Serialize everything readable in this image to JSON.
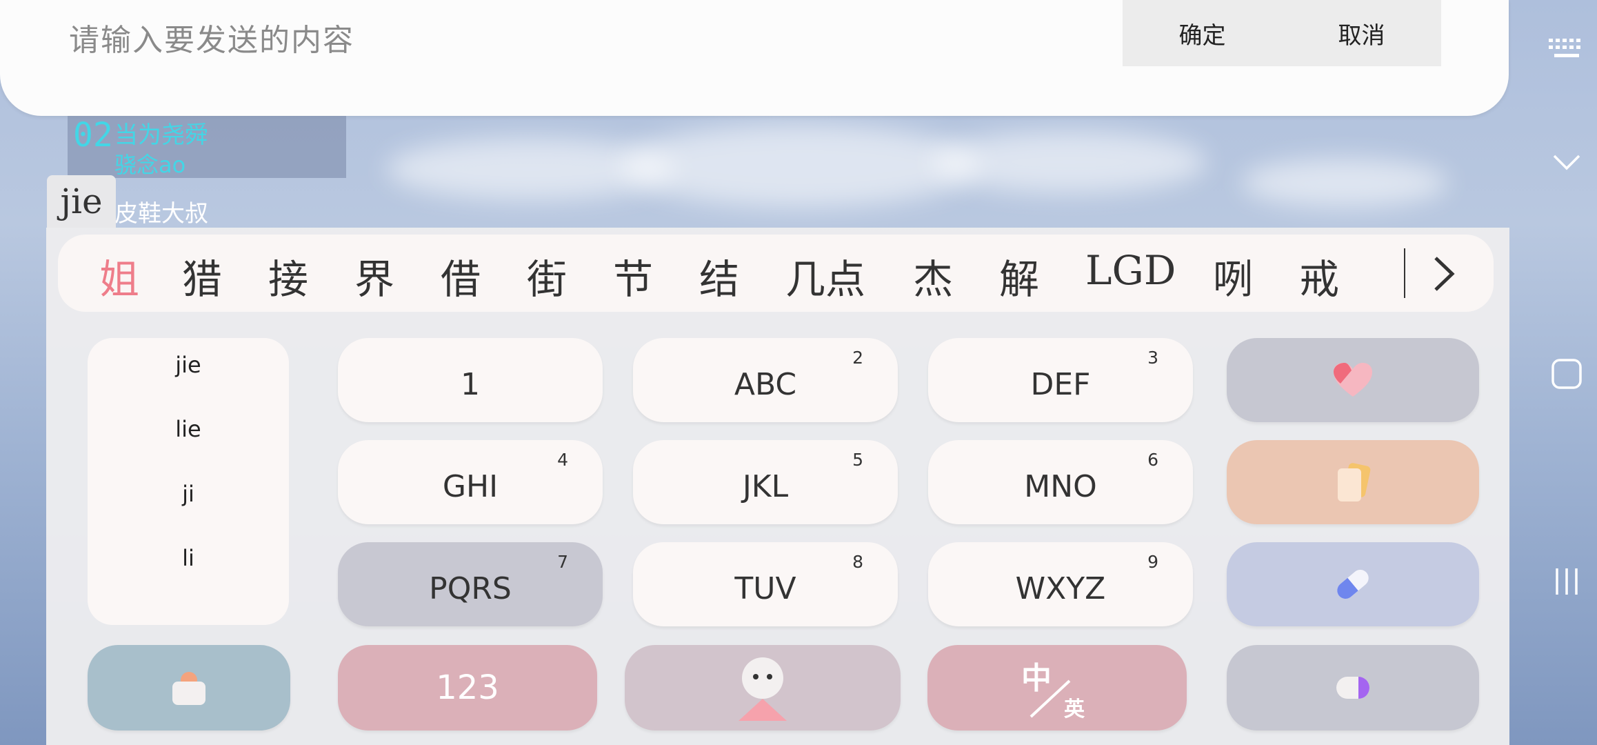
{
  "input": {
    "placeholder": "请输入要发送的内容",
    "confirm_label": "确定",
    "cancel_label": "取消"
  },
  "lyrics": {
    "number": "02",
    "line1": "当为尧舜",
    "line2": "骁念ao",
    "line3": "皮鞋大叔"
  },
  "composing_pinyin": "jie",
  "candidates": [
    "姐",
    "猎",
    "接",
    "界",
    "借",
    "街",
    "节",
    "结",
    "几点",
    "杰",
    "解",
    "LGD",
    "咧",
    "戒"
  ],
  "pinyin_options": [
    "jie",
    "lie",
    "ji",
    "li"
  ],
  "keys": {
    "k1": "1",
    "k2": {
      "label": "ABC",
      "num": "2"
    },
    "k3": {
      "label": "DEF",
      "num": "3"
    },
    "k4": {
      "label": "GHI",
      "num": "4"
    },
    "k5": {
      "label": "JKL",
      "num": "5"
    },
    "k6": {
      "label": "MNO",
      "num": "6"
    },
    "k7": {
      "label": "PQRS",
      "num": "7"
    },
    "k8": {
      "label": "TUV",
      "num": "8"
    },
    "k9": {
      "label": "WXYZ",
      "num": "9"
    },
    "numbers_label": "123",
    "lang_main": "中",
    "lang_sub": "英"
  },
  "icons": {
    "side": [
      "heart-icon",
      "cards-icon",
      "pill-icon",
      "toggle-icon"
    ],
    "bottom_left": "basket-icon",
    "space": "character-icon"
  },
  "colors": {
    "first_candidate": "#ee7d8a",
    "lyrics": "#43d6e6"
  }
}
